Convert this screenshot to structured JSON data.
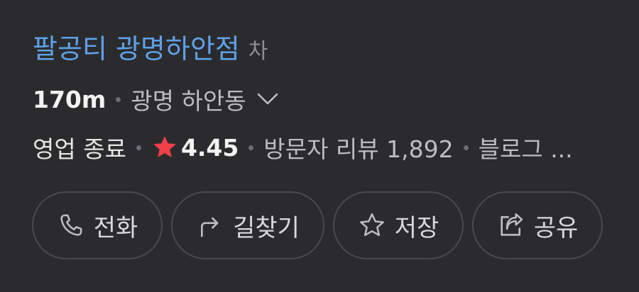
{
  "place": {
    "name": "팔공티 광명하안점",
    "category": "차"
  },
  "location": {
    "distance": "170m",
    "address": "광명 하안동"
  },
  "info": {
    "status": "영업 종료",
    "rating": "4.45",
    "visitor_reviews": "방문자 리뷰 1,892",
    "blog_reviews": "블로그 ..."
  },
  "actions": {
    "call": "전화",
    "directions": "길찾기",
    "save": "저장",
    "share": "공유"
  },
  "colors": {
    "background": "#2b2b2d",
    "title_link": "#5ea1ea",
    "star": "#f2404a",
    "button_border": "#4a4a4e"
  },
  "icons": {
    "address_expand": "chevron-down-icon",
    "rating": "star-icon",
    "call": "phone-icon",
    "directions": "turn-arrow-icon",
    "save": "star-outline-icon",
    "share": "share-icon"
  }
}
